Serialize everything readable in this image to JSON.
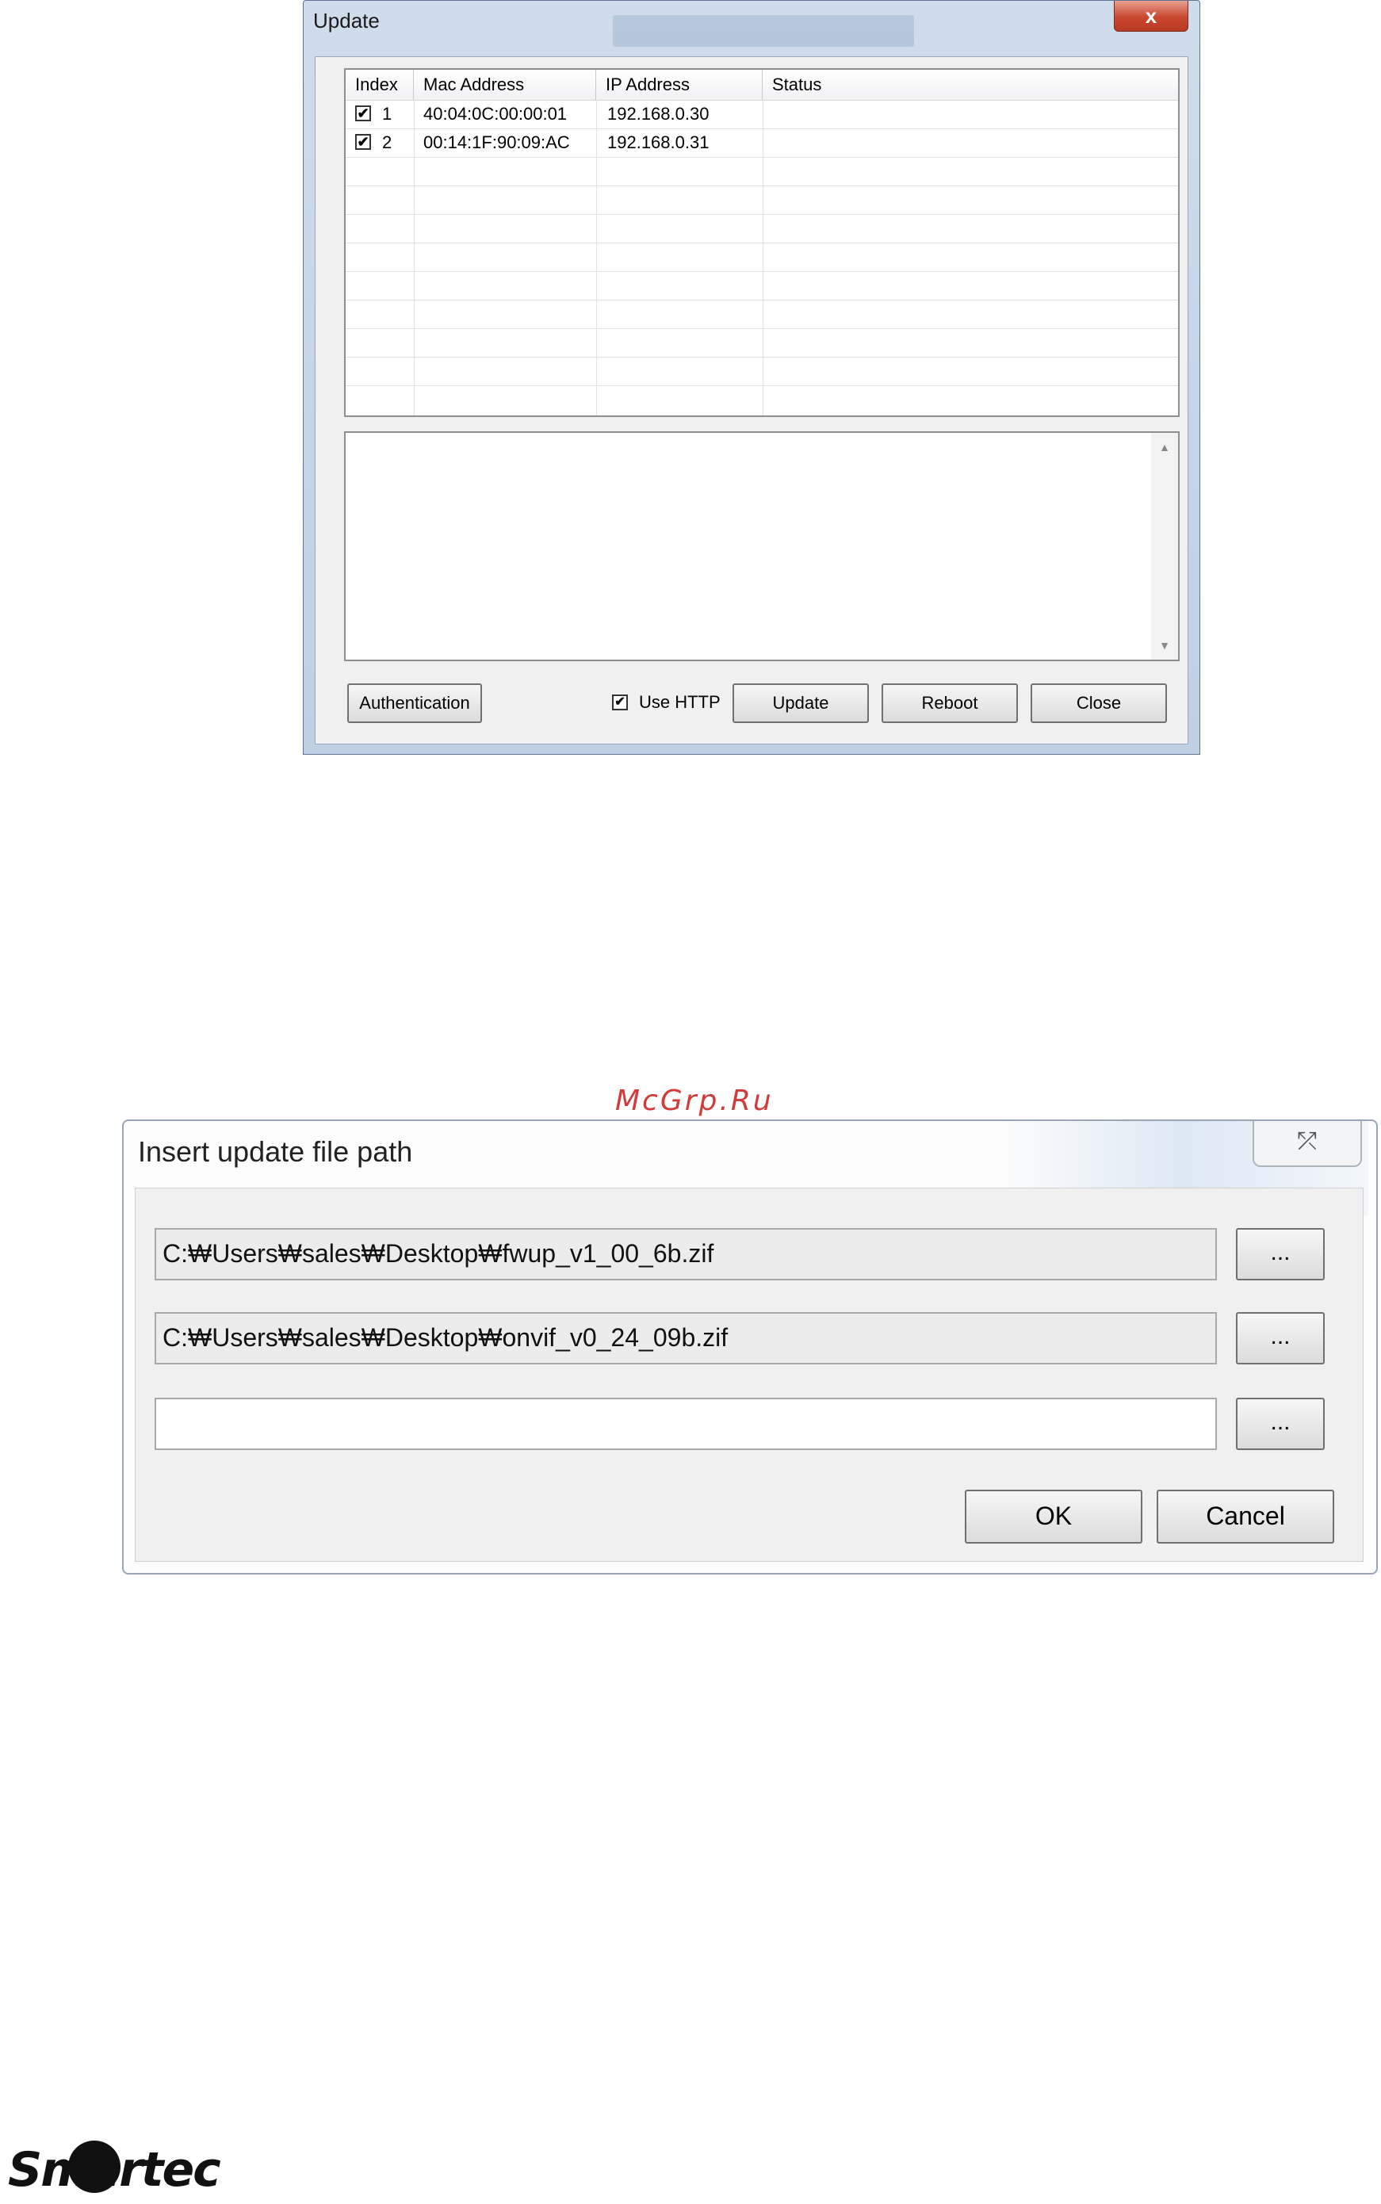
{
  "update_window": {
    "title": "Update",
    "close_glyph": "x",
    "columns": [
      "Index",
      "Mac Address",
      "IP Address",
      "Status"
    ],
    "rows": [
      {
        "checked": true,
        "index": "1",
        "mac": "40:04:0C:00:00:01",
        "ip": "192.168.0.30",
        "status": ""
      },
      {
        "checked": true,
        "index": "2",
        "mac": "00:14:1F:90:09:AC",
        "ip": "192.168.0.31",
        "status": ""
      }
    ],
    "empty_rows": 9,
    "scroll_up_glyph": "▲",
    "scroll_down_glyph": "▼",
    "buttons": {
      "authentication": "Authentication",
      "update": "Update",
      "reboot": "Reboot",
      "close": "Close"
    },
    "use_http": {
      "label": "Use HTTP",
      "checked": true
    },
    "check_glyph": "✔"
  },
  "watermark": "McGrp.Ru",
  "path_dialog": {
    "title": "Insert update file path",
    "close_glyph": "⤱",
    "fields": [
      {
        "value": "C:₩Users₩sales₩Desktop₩fwup_v1_00_6b.zif",
        "readonly": true
      },
      {
        "value": "C:₩Users₩sales₩Desktop₩onvif_v0_24_09b.zif",
        "readonly": true
      },
      {
        "value": "",
        "readonly": false
      }
    ],
    "browse_label": "...",
    "ok_label": "OK",
    "cancel_label": "Cancel"
  },
  "logo": {
    "text": "Smartec"
  }
}
